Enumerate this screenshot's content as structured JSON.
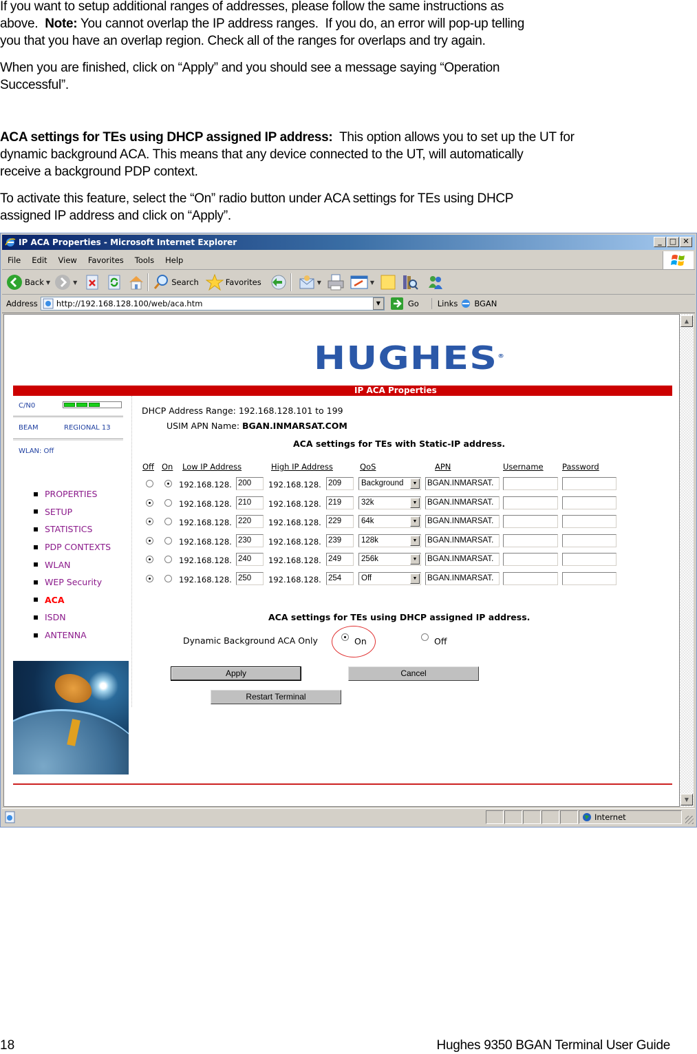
{
  "document": {
    "paragraphs": {
      "p1_line1": "If you want to setup additional ranges of addresses, please follow the same instructions as",
      "p1_line2_pre": "above.  ",
      "p1_note_label": "Note:",
      "p1_line2_post": " You cannot overlap the IP address ranges.  If you do, an error will pop-up telling",
      "p1_line3": "you that you have an overlap region.  Check all of the ranges for overlaps and try again.",
      "p2_line1": "When you are finished, click on “Apply” and you should see a message saying “Operation",
      "p2_line2": "Successful”.",
      "p3_heading": "ACA settings for TEs using DHCP assigned IP address:",
      "p3_line1_post": "  This option allows you to set up the UT for",
      "p3_line2": "dynamic background ACA.  This means that any device connected to the UT, will automatically",
      "p3_line3": "receive a background PDP context.",
      "p4_line1": "To activate this feature, select the “On” radio button under ACA settings for TEs using DHCP",
      "p4_line2": "assigned IP address and click on “Apply”."
    },
    "footer": {
      "page_number": "18",
      "guide_title": "Hughes 9350 BGAN Terminal User Guide"
    }
  },
  "browser": {
    "window_title": "IP ACA Properties - Microsoft Internet Explorer",
    "window_buttons": {
      "minimize": "_",
      "maximize": "□",
      "close": "✕"
    },
    "menu": [
      "File",
      "Edit",
      "View",
      "Favorites",
      "Tools",
      "Help"
    ],
    "menu_mnemonics": [
      "F",
      "E",
      "V",
      "a",
      "T",
      "H"
    ],
    "toolbar": {
      "back": "Back",
      "search": "Search",
      "favorites": "Favorites"
    },
    "address": {
      "label": "Address",
      "url": "http://192.168.128.100/web/aca.htm",
      "go": "Go",
      "links": "Links",
      "link_bgan": "BGAN"
    },
    "status": {
      "zone": "Internet"
    }
  },
  "page": {
    "logo": "HUGHES",
    "header_bar": "IP ACA Properties",
    "status_panel": {
      "cn0_label": "C/N0",
      "cn0_segments_lit": 3,
      "beam_label": "BEAM",
      "beam_value": "REGIONAL 13",
      "wlan_status": "WLAN: Off"
    },
    "nav": [
      {
        "label": "PROPERTIES",
        "active": false
      },
      {
        "label": "SETUP",
        "active": false
      },
      {
        "label": "STATISTICS",
        "active": false
      },
      {
        "label": "PDP CONTEXTS",
        "active": false
      },
      {
        "label": "WLAN",
        "active": false
      },
      {
        "label": "WEP Security",
        "active": false
      },
      {
        "label": "ACA",
        "active": true
      },
      {
        "label": "ISDN",
        "active": false
      },
      {
        "label": "ANTENNA",
        "active": false
      }
    ],
    "dhcp_range": "DHCP Address Range: 192.168.128.101 to 199",
    "usim_apn_label": "USIM APN Name: ",
    "usim_apn_value": "BGAN.INMARSAT.COM",
    "static_section_title": "ACA settings for TEs with Static-IP address.",
    "columns": {
      "off": "Off",
      "on": "On",
      "low_ip": "Low IP Address",
      "high_ip": "High IP Address",
      "qos": "QoS",
      "apn": "APN",
      "username": "Username",
      "password": "Password"
    },
    "ip_prefix": "192.168.128.",
    "rows": [
      {
        "state": "on",
        "low": "200",
        "high": "209",
        "qos": "Background",
        "apn": "BGAN.INMARSAT.",
        "username": "",
        "password": ""
      },
      {
        "state": "off",
        "low": "210",
        "high": "219",
        "qos": "32k",
        "apn": "BGAN.INMARSAT.",
        "username": "",
        "password": ""
      },
      {
        "state": "off",
        "low": "220",
        "high": "229",
        "qos": "64k",
        "apn": "BGAN.INMARSAT.",
        "username": "",
        "password": ""
      },
      {
        "state": "off",
        "low": "230",
        "high": "239",
        "qos": "128k",
        "apn": "BGAN.INMARSAT.",
        "username": "",
        "password": ""
      },
      {
        "state": "off",
        "low": "240",
        "high": "249",
        "qos": "256k",
        "apn": "BGAN.INMARSAT.",
        "username": "",
        "password": ""
      },
      {
        "state": "off",
        "low": "250",
        "high": "254",
        "qos": "Off",
        "apn": "BGAN.INMARSAT.",
        "username": "",
        "password": ""
      }
    ],
    "dhcp_section_title": "ACA settings for TEs using DHCP assigned IP address.",
    "dynamic_label": "Dynamic Background ACA Only",
    "dynamic_on": "On",
    "dynamic_off": "Off",
    "dynamic_selected": "on",
    "buttons": {
      "apply": "Apply",
      "cancel": "Cancel",
      "restart": "Restart Terminal"
    }
  }
}
